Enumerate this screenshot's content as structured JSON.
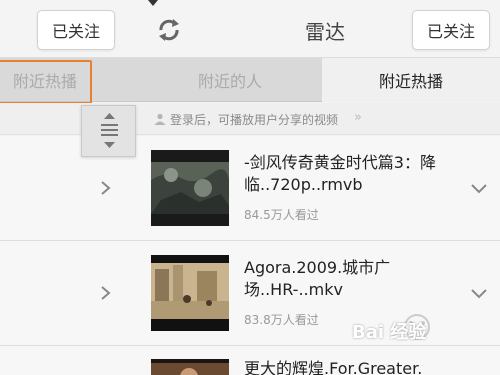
{
  "header": {
    "follow_left_label": "已关注",
    "follow_right_label": "已关注",
    "title": "雷达",
    "refresh_icon": "refresh-icon"
  },
  "tabs": [
    {
      "label": "附近热播"
    },
    {
      "label": "附近的人"
    },
    {
      "label": "附近热播"
    }
  ],
  "notice": {
    "text": "登录后，可播放用户分享的视频",
    "icon": "user-icon"
  },
  "videos": [
    {
      "title": "-剑风传奇黄金时代篇3：降临..720p..rmvb",
      "views": "84.5万人看过"
    },
    {
      "title": "Agora.2009.城市广场..HR-..mkv",
      "views": "83.8万人看过"
    },
    {
      "title": "更大的辉煌.For.Greater.",
      "views": ""
    }
  ],
  "watermark": {
    "text": "Bai 经验"
  },
  "colors": {
    "highlight_border": "#e58232",
    "active_tab_bg": "#f0f0f0",
    "tab_bar_bg": "#d9d9d9"
  }
}
